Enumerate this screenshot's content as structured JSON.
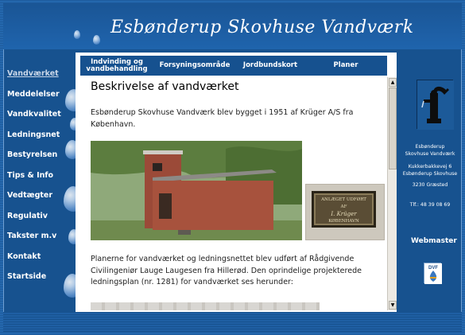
{
  "site": {
    "title": "Esbønderup Skovhuse Vandværk"
  },
  "sidebar": {
    "items": [
      {
        "label": "Vandværket",
        "active": true
      },
      {
        "label": "Meddelelser",
        "active": false
      },
      {
        "label": "Vandkvalitet",
        "active": false
      },
      {
        "label": "Ledningsnet",
        "active": false
      },
      {
        "label": "Bestyrelsen",
        "active": false
      },
      {
        "label": "Tips & Info",
        "active": false
      },
      {
        "label": "Vedtægter",
        "active": false
      },
      {
        "label": "Regulativ",
        "active": false
      },
      {
        "label": "Takster m.v",
        "active": false
      },
      {
        "label": "Kontakt",
        "active": false
      },
      {
        "label": "Startside",
        "active": false
      }
    ]
  },
  "tabs": [
    {
      "label": "Indvinding og vandbehandling"
    },
    {
      "label": "Forsyningsområde"
    },
    {
      "label": "Jordbundskort"
    },
    {
      "label": "Planer"
    }
  ],
  "content": {
    "heading": "Beskrivelse af vandværket",
    "intro": "Esbønderup Skovhuse Vandværk blev bygget i 1951 af Krüger A/S fra København.",
    "plaque_line1": "ANLÆGET UDFØRT",
    "plaque_line2": "AF",
    "plaque_line3": "I. Krüger",
    "plaque_line4": "KØBENHAVN",
    "plans_text": "Planerne for vandværket og ledningsnettet blev udført af Rådgivende Civilingeniør Lauge Laugesen fra Hillerød. Den oprindelige projekterede ledningsplan (nr. 1281) for vandværket ses herunder:"
  },
  "contact": {
    "name_line1": "Esbønderup",
    "name_line2": "Skovhuse Vandværk",
    "street": "Kukkerbakkevej 6",
    "town_line": "Esbønderup Skovhuse",
    "postal": "3230 Græsted",
    "phone": "Tlf.: 48 39 08 69",
    "webmaster_label": "Webmaster",
    "dvf_label": "DVF"
  },
  "colors": {
    "background": "#1f5fa3",
    "header": "#1a5595",
    "tabbar": "#16518f",
    "text": "#222222"
  }
}
